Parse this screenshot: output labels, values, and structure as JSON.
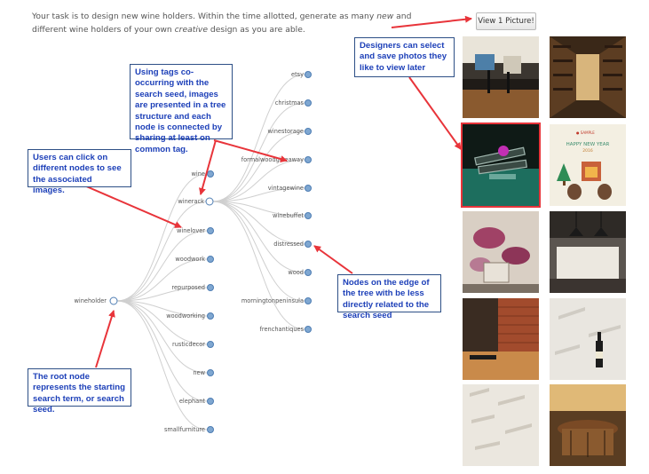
{
  "instructions": {
    "part1": "Your task is to design new wine holders. Within the time allotted, generate as many ",
    "new": "new",
    "part2": " and different wine holders of your own ",
    "creative": "creative",
    "part3": " design as you are able."
  },
  "view_button": {
    "label": "View 1 Picture!"
  },
  "tree": {
    "root": "wineholder",
    "level1": [
      "wine",
      "winerack",
      "winelover",
      "woodwork",
      "repurposed",
      "woodworking",
      "rusticdecor",
      "new",
      "elephant",
      "smallfurniture"
    ],
    "level2": [
      "etsy",
      "christmas",
      "winestorage",
      "formalwoodgiveaway",
      "vintagewine",
      "winebuffet",
      "distressed",
      "wood",
      "morningtonpeninsula",
      "frenchantiques"
    ]
  },
  "callouts": {
    "tags": "Using tags co-occurring with the search seed, images are presented in a tree structure and each node is connected by sharing at least on common tag.",
    "designers": "Designers can select and save photos they like to view later",
    "users": "Users can click on different nodes to see the associated images.",
    "edge": "Nodes on the edge of the tree with be less directly related to the search seed",
    "root": "The root node represents the starting search term, or search seed."
  },
  "photos": [
    {
      "name": "kitchen-photo",
      "selected": false
    },
    {
      "name": "wine-cellar-photo",
      "selected": false
    },
    {
      "name": "wine-rack-photo",
      "selected": true
    },
    {
      "name": "new-year-card-photo",
      "selected": false
    },
    {
      "name": "floral-room-photo",
      "selected": false
    },
    {
      "name": "pendant-kitchen-photo",
      "selected": false
    },
    {
      "name": "brick-wall-shelf-photo",
      "selected": false
    },
    {
      "name": "wall-bottle-rack-photo",
      "selected": false
    },
    {
      "name": "white-wall-rack-photo",
      "selected": false
    },
    {
      "name": "barrel-table-photo",
      "selected": false
    }
  ],
  "card_text": {
    "brand": "● SAMPLE",
    "greeting": "HAPPY NEW YEAR",
    "year": "2016"
  },
  "colors": {
    "accent_red": "#e8343a",
    "callout_text": "#1c3fb8",
    "node_fill": "#7fa7d1"
  }
}
